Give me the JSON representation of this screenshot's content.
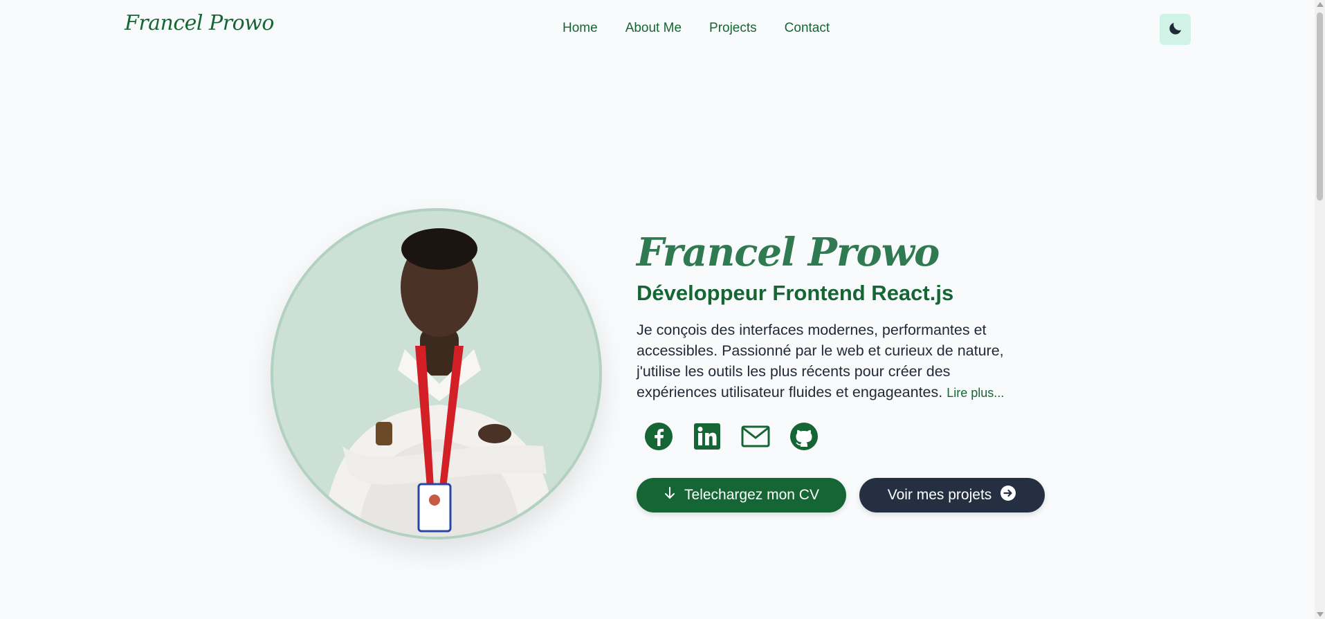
{
  "header": {
    "logo": "Francel Prowo",
    "nav": [
      {
        "label": "Home"
      },
      {
        "label": "About Me"
      },
      {
        "label": "Projects"
      },
      {
        "label": "Contact"
      }
    ],
    "theme_toggle_icon": "moon-icon"
  },
  "hero": {
    "name": "Francel Prowo",
    "role": "Développeur Frontend React.js",
    "description": "Je conçois des interfaces modernes, performantes et accessibles. Passionné par le web et curieux de nature, j'utilise les outils les plus récents pour créer des expériences utilisateur fluides et engageantes.",
    "read_more": "Lire plus...",
    "portrait_icon": "profile-photo",
    "socials": [
      {
        "name": "facebook-icon"
      },
      {
        "name": "linkedin-icon"
      },
      {
        "name": "mail-icon"
      },
      {
        "name": "github-icon"
      }
    ],
    "cta_primary": {
      "label": "Telechargez mon CV",
      "icon": "arrow-down-icon"
    },
    "cta_secondary": {
      "label": "Voir mes projets",
      "icon": "arrow-right-circle-icon"
    }
  },
  "colors": {
    "accent": "#166534",
    "secondary_button": "#243042",
    "background": "#f8fafb",
    "portrait_bg": "#cde0d6",
    "toggle_bg": "#d1f2e6"
  }
}
